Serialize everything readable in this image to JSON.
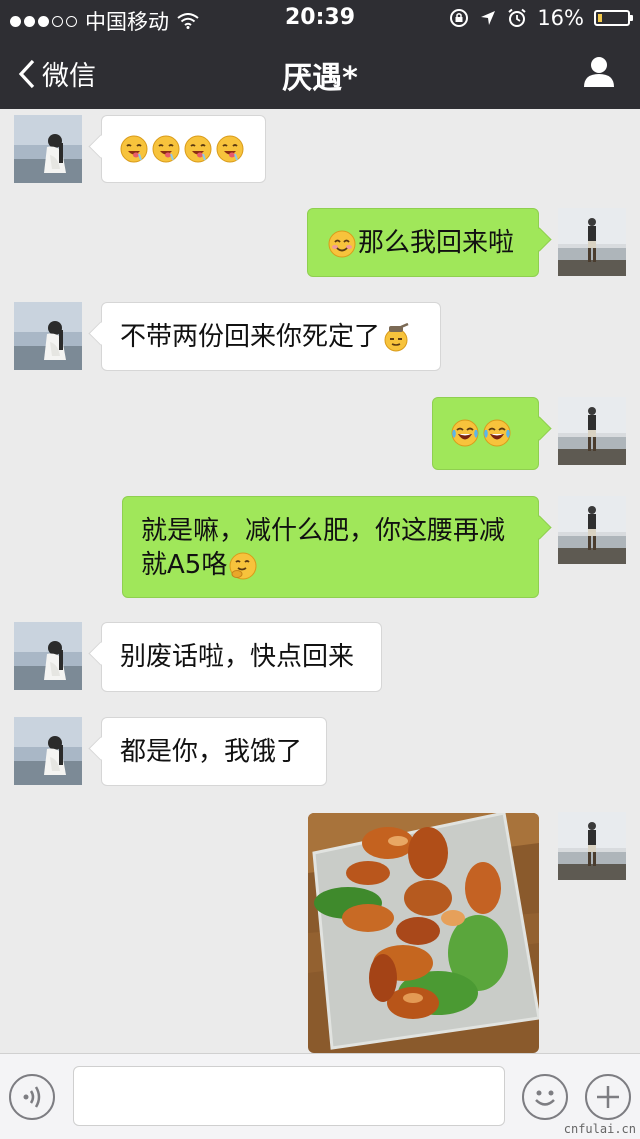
{
  "status_bar": {
    "carrier": "中国移动",
    "time": "20:39",
    "battery": "16%",
    "battery_level": 0.16
  },
  "nav": {
    "back_label": "微信",
    "title": "厌遇*"
  },
  "messages": [
    {
      "side": "in",
      "text": "",
      "emoji": [
        "drooling-face",
        "drooling-face",
        "drooling-face",
        "drooling-face"
      ]
    },
    {
      "side": "out",
      "text": "那么我回来啦",
      "emoji": [
        "smiling-face"
      ]
    },
    {
      "side": "in",
      "text": "不带两份回来你死定了",
      "emoji": [
        "bomb"
      ]
    },
    {
      "side": "out",
      "text": "",
      "emoji": [
        "tears-of-joy",
        "tears-of-joy"
      ]
    },
    {
      "side": "out",
      "text": "就是嘛，减什么肥，你这腰再减就A5咯",
      "emoji": [
        "chuckle-face"
      ]
    },
    {
      "side": "in",
      "text": "别废话啦，快点回来"
    },
    {
      "side": "in",
      "text": "都是你，我饿了"
    },
    {
      "side": "out",
      "type": "image",
      "image": "braised-pork-trotters-photo"
    }
  ],
  "watermark": "cnfulai.cn"
}
